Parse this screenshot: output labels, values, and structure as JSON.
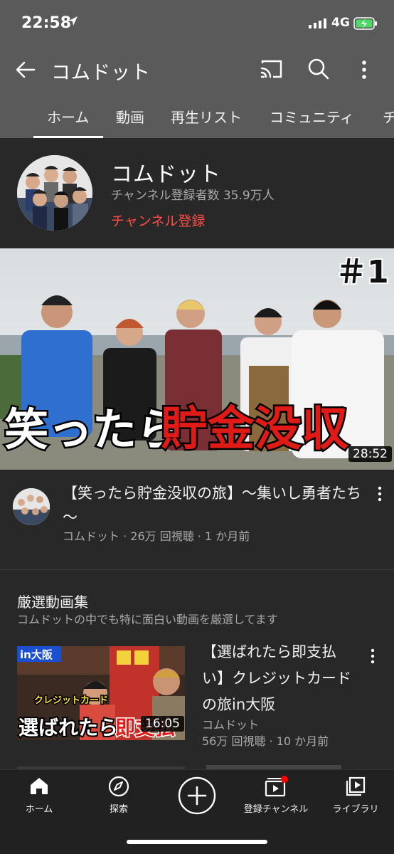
{
  "status": {
    "time": "22:58",
    "network": "4G"
  },
  "appbar": {
    "title": "コムドット"
  },
  "tabs": [
    "ホーム",
    "動画",
    "再生リスト",
    "コミュニティ",
    "チ"
  ],
  "channel": {
    "name": "コムドット",
    "subscribers": "チャンネル登録者数 35.9万人",
    "subscribe_label": "チャンネル登録"
  },
  "featured": {
    "overlay_caption_a": "笑ったら",
    "overlay_caption_b": "貯金没収",
    "episode_badge": "＃1",
    "duration": "28:52",
    "title": "【笑ったら貯金没収の旅】～集いし勇者たち～",
    "meta": "コムドット · 26万 回視聴 · 1 か月前"
  },
  "section": {
    "title": "厳選動画集",
    "description": "コムドットの中でも特に面白い動画を厳選してます"
  },
  "video2": {
    "thumb_tag": "in大阪",
    "thumb_caption_top": "クレジットカード",
    "thumb_caption_a": "選ばれたら",
    "thumb_caption_b": "即支払",
    "duration": "16:05",
    "title": "【選ばれたら即支払い】クレジットカードの旅in大阪",
    "channel": "コムドット",
    "meta": "56万 回視聴 · 10 か月前"
  },
  "bottom_nav": {
    "home": "ホーム",
    "explore": "探索",
    "subscriptions": "登録チャンネル",
    "library": "ライブラリ"
  },
  "colors": {
    "accent_red": "#ff4e45",
    "bar_gray": "#5a5a5a",
    "background": "#282828"
  }
}
